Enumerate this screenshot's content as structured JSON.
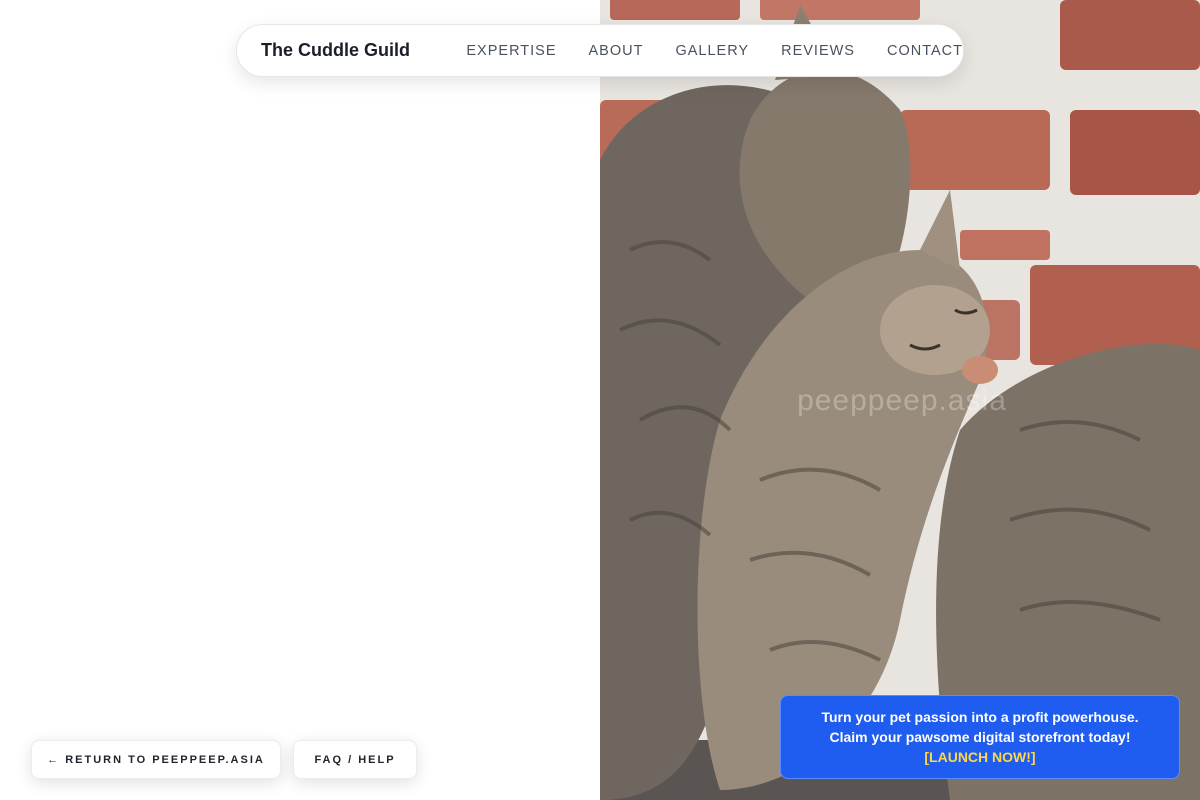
{
  "nav": {
    "brand": "The Cuddle Guild",
    "links": [
      "EXPERTISE",
      "ABOUT",
      "GALLERY",
      "REVIEWS",
      "CONTACT"
    ]
  },
  "hero_image": {
    "watermark": "peeppeep.asia",
    "alt": "Two tabby cats cuddling in front of a brick wall"
  },
  "footer_buttons": {
    "return_label": "← RETURN TO PEEPPEEP.ASIA",
    "faq_label": "FAQ / HELP"
  },
  "promo": {
    "line1": "Turn your pet passion into a profit powerhouse.",
    "line2": "Claim your pawsome digital storefront today!",
    "cta": "[LAUNCH NOW!]"
  },
  "colors": {
    "promo_bg": "#1f5cf0",
    "promo_cta": "#ffd84a",
    "nav_text": "#4a5160",
    "brand_text": "#1b1f2a"
  }
}
